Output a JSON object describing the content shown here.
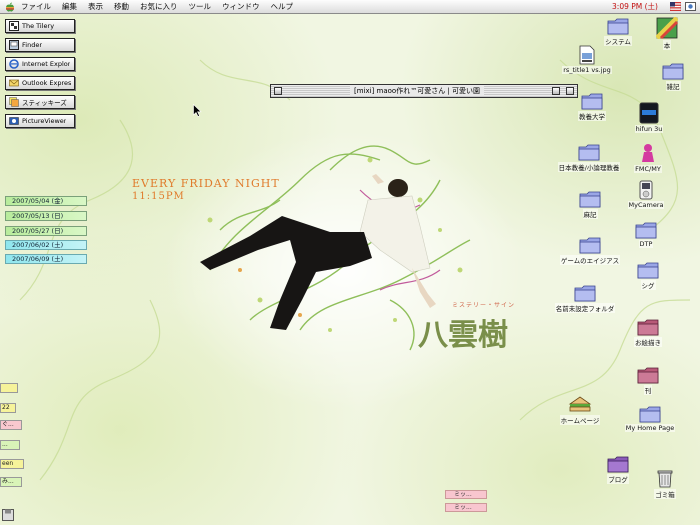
{
  "menubar": {
    "items": [
      "ファイル",
      "編集",
      "表示",
      "移動",
      "お気に入り",
      "ツール",
      "ウィンドウ",
      "ヘルプ"
    ],
    "clock": "3:09 PM (土)",
    "clock_color": "#c21010"
  },
  "launcher": [
    {
      "label": "The Tilery",
      "icon": "tilery-icon"
    },
    {
      "label": "Finder",
      "icon": "finder-icon"
    },
    {
      "label": "Internet Explor",
      "icon": "internet-explorer-icon"
    },
    {
      "label": "Outlook Expres",
      "icon": "outlook-express-icon"
    },
    {
      "label": "スティッキーズ",
      "icon": "stickies-icon"
    },
    {
      "label": "PictureViewer",
      "icon": "picture-viewer-icon"
    }
  ],
  "dates": [
    {
      "label": "2007/05/04 (金)",
      "tone": "green"
    },
    {
      "label": "2007/05/13 (日)",
      "tone": "green"
    },
    {
      "label": "2007/05/27 (日)",
      "tone": "green"
    },
    {
      "label": "2007/06/02 (土)",
      "tone": "cyan"
    },
    {
      "label": "2007/06/09 (土)",
      "tone": "cyan"
    }
  ],
  "side_tabs": [
    "",
    "22",
    "ぐ...",
    "...",
    "een",
    "み..."
  ],
  "bottom_tabs": [
    "ミッ...",
    "ミッ..."
  ],
  "window": {
    "title": "[mixi] maoo作れ™可愛さん | 可愛い園"
  },
  "wallpaper": {
    "line1": "EVERY FRIDAY NIGHT",
    "line2": "11:15PM",
    "brand_small": "ミステリー・サイン",
    "brand_big": "八雲樹"
  },
  "desktop_icons": {
    "system": "システム",
    "jpg": "rs_title1 vs.jpg",
    "edu": "教養大学",
    "japan": "日本教養/小論理教養",
    "asami": "麻記",
    "game": "ゲームのエイジアス",
    "unsorted": "名前未設定フォルダ",
    "homepage": "ホームページ",
    "books": "本",
    "misc": "雑記",
    "hifun": "hifun 3u",
    "fmc": "FMC/MY",
    "ipod": "MyCamera",
    "dtp": "DTP",
    "shig": "シグ",
    "saved": "お絵描き",
    "kan": "刊",
    "myhome": "My Home Page",
    "blog": "ブログ",
    "trash": "ゴミ箱"
  }
}
